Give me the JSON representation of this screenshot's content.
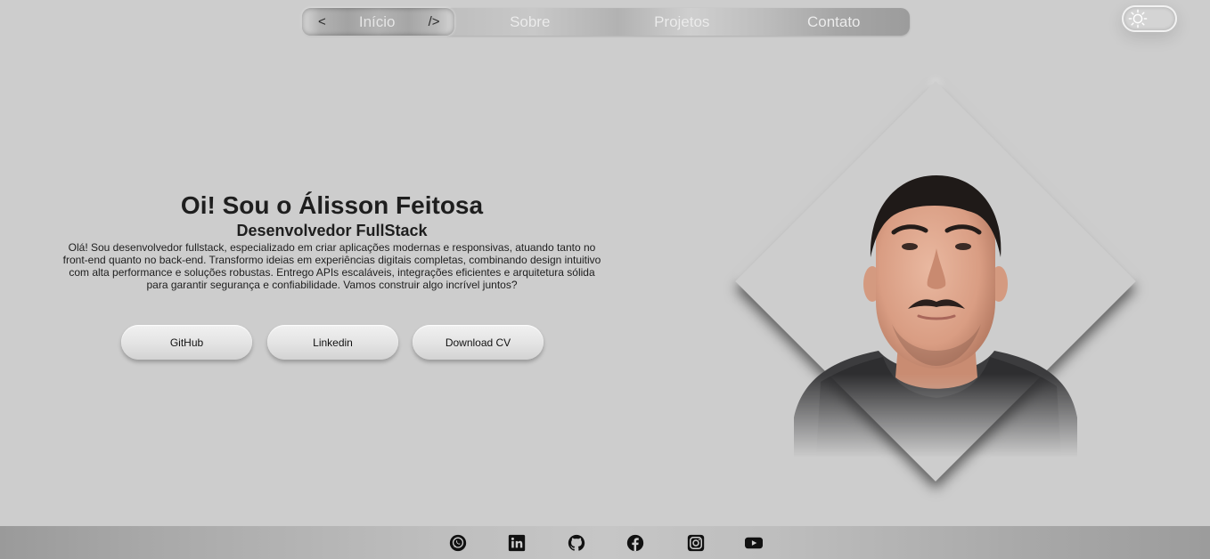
{
  "nav": {
    "items": [
      {
        "label": "Início",
        "active": true,
        "prefix": "<",
        "suffix": "/>"
      },
      {
        "label": "Sobre",
        "active": false
      },
      {
        "label": "Projetos",
        "active": false
      },
      {
        "label": "Contato",
        "active": false
      }
    ]
  },
  "theme_toggle": {
    "icon": "sun-icon",
    "state": "light"
  },
  "hero": {
    "title": "Oi! Sou o Álisson Feitosa",
    "subtitle": "Desenvolvedor FullStack",
    "description": "Olá! Sou desenvolvedor fullstack, especializado em criar aplicações modernas e responsivas, atuando tanto no front-end quanto no back-end. Transformo ideias em experiências digitais completas, combinando design intuitivo com alta performance e soluções robustas. Entrego APIs escaláveis, integrações eficientes e arquitetura sólida para garantir segurança e confiabilidade. Vamos construir algo incrível juntos?"
  },
  "buttons": {
    "github": "GitHub",
    "linkedin": "Linkedin",
    "download_cv": "Download CV"
  },
  "footer": {
    "social_icons": [
      "whatsapp-icon",
      "linkedin-icon",
      "github-icon",
      "facebook-icon",
      "instagram-icon",
      "youtube-icon"
    ]
  },
  "colors": {
    "background": "#cdcdcd",
    "text": "#1e1e1e",
    "nav_text": "#ececec",
    "icon": "#111111"
  }
}
